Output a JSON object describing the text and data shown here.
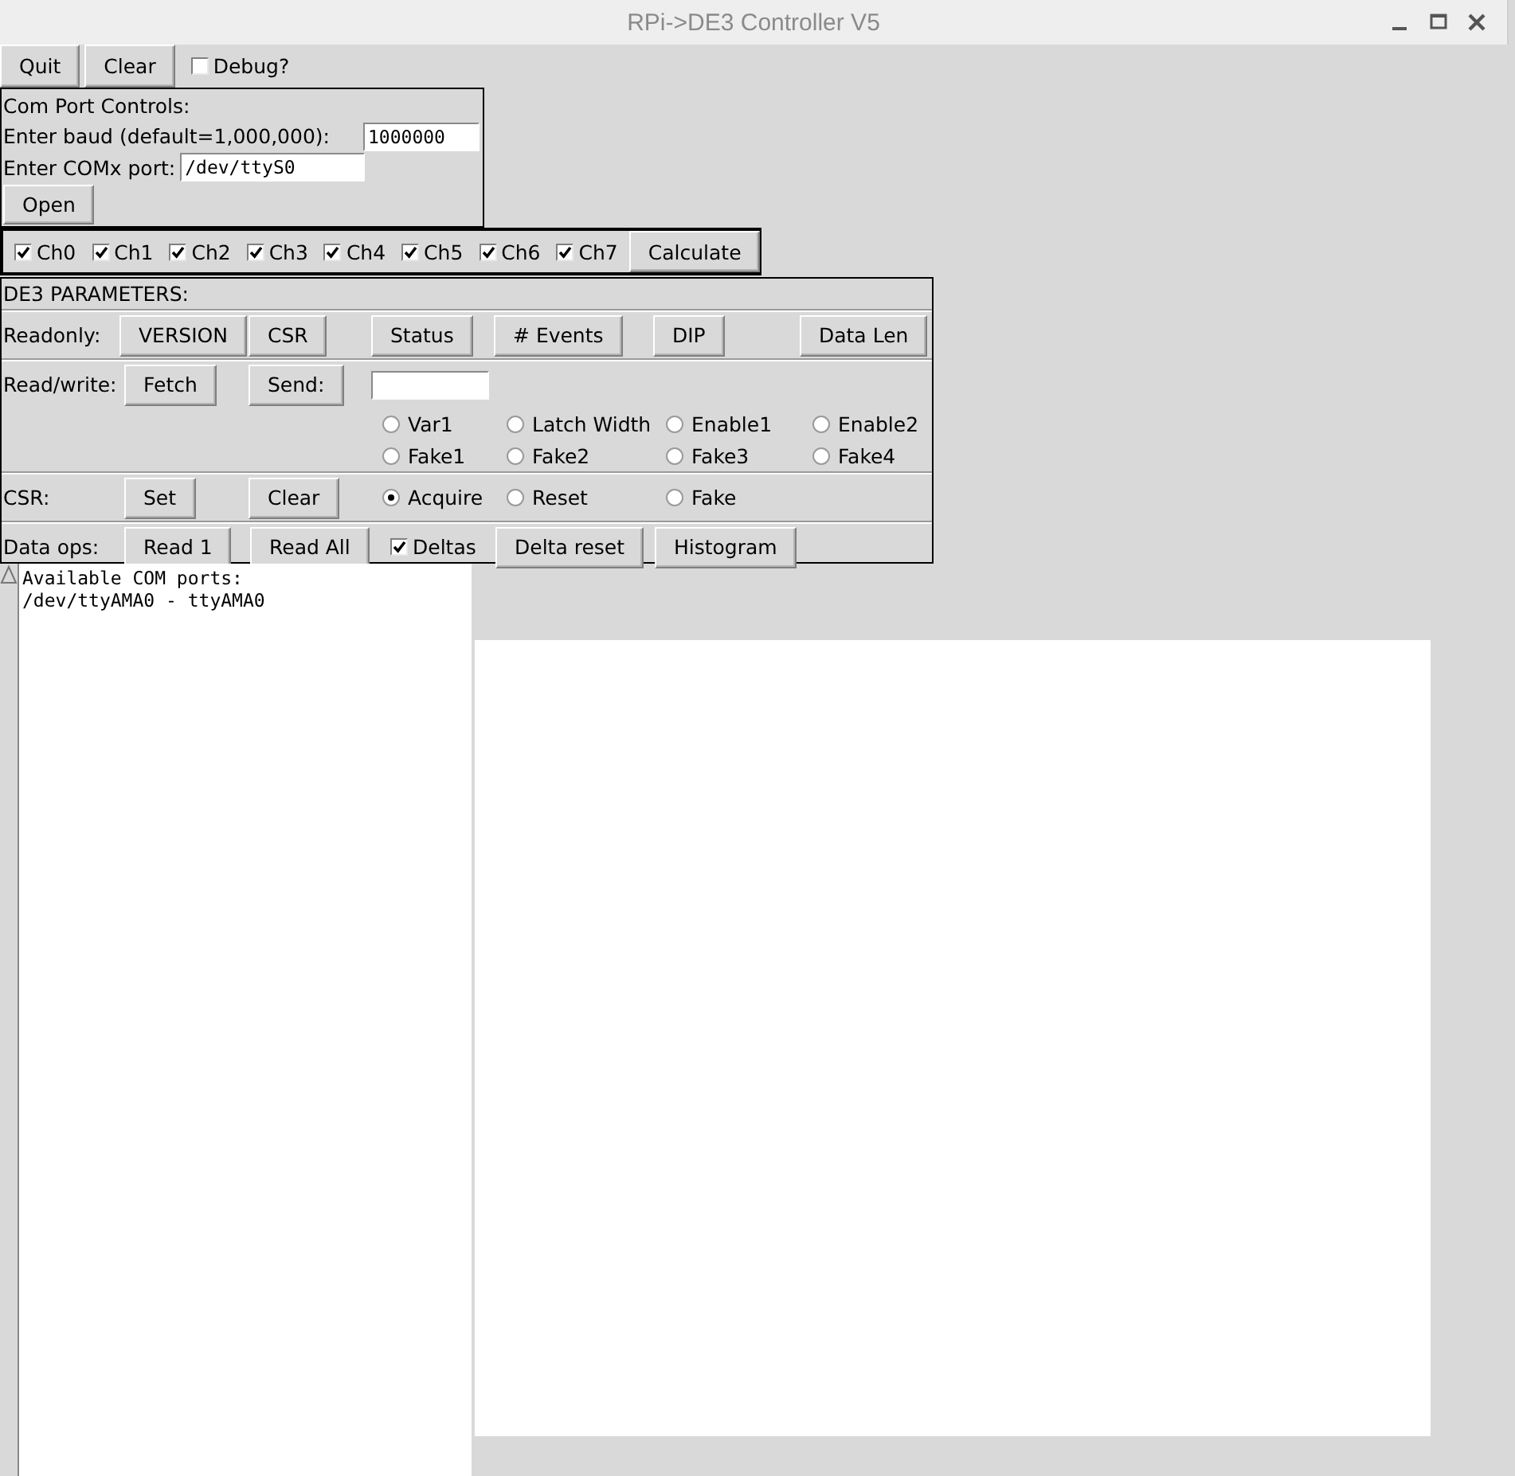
{
  "window": {
    "title": "RPi->DE3 Controller V5"
  },
  "top_bar": {
    "buttons": [
      "Quit",
      "Clear"
    ],
    "debug": {
      "label": "Debug?",
      "checked": false
    }
  },
  "com_port": {
    "heading": "Com Port Controls:",
    "baud": {
      "label": "Enter baud (default=1,000,000):",
      "value": "1000000"
    },
    "port": {
      "label": "Enter COMx port:",
      "value": "/dev/ttyS0"
    },
    "open_button": "Open"
  },
  "channels": [
    {
      "label": "Ch0",
      "checked": true
    },
    {
      "label": "Ch1",
      "checked": true
    },
    {
      "label": "Ch2",
      "checked": true
    },
    {
      "label": "Ch3",
      "checked": true
    },
    {
      "label": "Ch4",
      "checked": true
    },
    {
      "label": "Ch5",
      "checked": true
    },
    {
      "label": "Ch6",
      "checked": true
    },
    {
      "label": "Ch7",
      "checked": true
    }
  ],
  "calculate_button": "Calculate",
  "de3": {
    "heading": "DE3 PARAMETERS:",
    "readonly": {
      "label": "Readonly:",
      "buttons": [
        "VERSION",
        "CSR",
        "Status",
        "# Events",
        "DIP",
        "Data Len"
      ]
    },
    "read_write": {
      "label": "Read/write:",
      "buttons": [
        "Fetch",
        "Send:"
      ],
      "registers": [
        {
          "label": "Var1",
          "selected": false
        },
        {
          "label": "Latch Width",
          "selected": false
        },
        {
          "label": "Enable1",
          "selected": false
        },
        {
          "label": "Enable2",
          "selected": false
        },
        {
          "label": "Fake1",
          "selected": false
        },
        {
          "label": "Fake2",
          "selected": false
        },
        {
          "label": "Fake3",
          "selected": false
        },
        {
          "label": "Fake4",
          "selected": false
        }
      ]
    },
    "csr": {
      "label": "CSR:",
      "buttons": [
        "Set",
        "Clear"
      ],
      "modes": [
        {
          "label": "Acquire",
          "selected": true
        },
        {
          "label": "Reset",
          "selected": false
        },
        {
          "label": "Fake",
          "selected": false
        }
      ]
    },
    "data_ops": {
      "label": "Data ops:",
      "items": [
        {
          "kind": "button",
          "label": "Read 1"
        },
        {
          "kind": "button",
          "label": "Read All"
        },
        {
          "kind": "checkbox",
          "label": "Deltas",
          "checked": true
        },
        {
          "kind": "button",
          "label": "Delta reset"
        },
        {
          "kind": "button",
          "label": "Histogram"
        }
      ]
    }
  },
  "console": {
    "lines": [
      "Available COM ports:",
      "/dev/ttyAMA0 - ttyAMA0"
    ]
  }
}
